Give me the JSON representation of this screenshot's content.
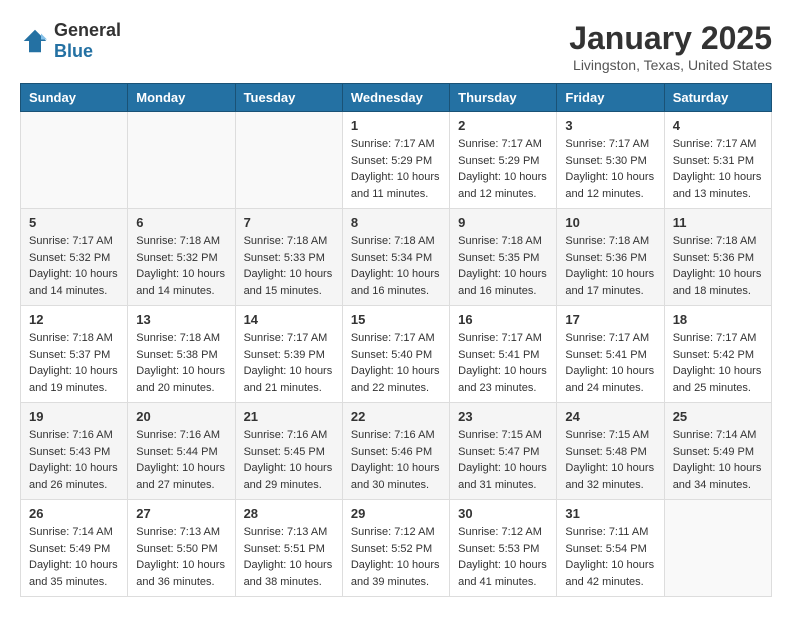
{
  "header": {
    "logo_general": "General",
    "logo_blue": "Blue",
    "month": "January 2025",
    "location": "Livingston, Texas, United States"
  },
  "weekdays": [
    "Sunday",
    "Monday",
    "Tuesday",
    "Wednesday",
    "Thursday",
    "Friday",
    "Saturday"
  ],
  "weeks": [
    [
      {
        "day": "",
        "info": ""
      },
      {
        "day": "",
        "info": ""
      },
      {
        "day": "",
        "info": ""
      },
      {
        "day": "1",
        "info": "Sunrise: 7:17 AM\nSunset: 5:29 PM\nDaylight: 10 hours\nand 11 minutes."
      },
      {
        "day": "2",
        "info": "Sunrise: 7:17 AM\nSunset: 5:29 PM\nDaylight: 10 hours\nand 12 minutes."
      },
      {
        "day": "3",
        "info": "Sunrise: 7:17 AM\nSunset: 5:30 PM\nDaylight: 10 hours\nand 12 minutes."
      },
      {
        "day": "4",
        "info": "Sunrise: 7:17 AM\nSunset: 5:31 PM\nDaylight: 10 hours\nand 13 minutes."
      }
    ],
    [
      {
        "day": "5",
        "info": "Sunrise: 7:17 AM\nSunset: 5:32 PM\nDaylight: 10 hours\nand 14 minutes."
      },
      {
        "day": "6",
        "info": "Sunrise: 7:18 AM\nSunset: 5:32 PM\nDaylight: 10 hours\nand 14 minutes."
      },
      {
        "day": "7",
        "info": "Sunrise: 7:18 AM\nSunset: 5:33 PM\nDaylight: 10 hours\nand 15 minutes."
      },
      {
        "day": "8",
        "info": "Sunrise: 7:18 AM\nSunset: 5:34 PM\nDaylight: 10 hours\nand 16 minutes."
      },
      {
        "day": "9",
        "info": "Sunrise: 7:18 AM\nSunset: 5:35 PM\nDaylight: 10 hours\nand 16 minutes."
      },
      {
        "day": "10",
        "info": "Sunrise: 7:18 AM\nSunset: 5:36 PM\nDaylight: 10 hours\nand 17 minutes."
      },
      {
        "day": "11",
        "info": "Sunrise: 7:18 AM\nSunset: 5:36 PM\nDaylight: 10 hours\nand 18 minutes."
      }
    ],
    [
      {
        "day": "12",
        "info": "Sunrise: 7:18 AM\nSunset: 5:37 PM\nDaylight: 10 hours\nand 19 minutes."
      },
      {
        "day": "13",
        "info": "Sunrise: 7:18 AM\nSunset: 5:38 PM\nDaylight: 10 hours\nand 20 minutes."
      },
      {
        "day": "14",
        "info": "Sunrise: 7:17 AM\nSunset: 5:39 PM\nDaylight: 10 hours\nand 21 minutes."
      },
      {
        "day": "15",
        "info": "Sunrise: 7:17 AM\nSunset: 5:40 PM\nDaylight: 10 hours\nand 22 minutes."
      },
      {
        "day": "16",
        "info": "Sunrise: 7:17 AM\nSunset: 5:41 PM\nDaylight: 10 hours\nand 23 minutes."
      },
      {
        "day": "17",
        "info": "Sunrise: 7:17 AM\nSunset: 5:41 PM\nDaylight: 10 hours\nand 24 minutes."
      },
      {
        "day": "18",
        "info": "Sunrise: 7:17 AM\nSunset: 5:42 PM\nDaylight: 10 hours\nand 25 minutes."
      }
    ],
    [
      {
        "day": "19",
        "info": "Sunrise: 7:16 AM\nSunset: 5:43 PM\nDaylight: 10 hours\nand 26 minutes."
      },
      {
        "day": "20",
        "info": "Sunrise: 7:16 AM\nSunset: 5:44 PM\nDaylight: 10 hours\nand 27 minutes."
      },
      {
        "day": "21",
        "info": "Sunrise: 7:16 AM\nSunset: 5:45 PM\nDaylight: 10 hours\nand 29 minutes."
      },
      {
        "day": "22",
        "info": "Sunrise: 7:16 AM\nSunset: 5:46 PM\nDaylight: 10 hours\nand 30 minutes."
      },
      {
        "day": "23",
        "info": "Sunrise: 7:15 AM\nSunset: 5:47 PM\nDaylight: 10 hours\nand 31 minutes."
      },
      {
        "day": "24",
        "info": "Sunrise: 7:15 AM\nSunset: 5:48 PM\nDaylight: 10 hours\nand 32 minutes."
      },
      {
        "day": "25",
        "info": "Sunrise: 7:14 AM\nSunset: 5:49 PM\nDaylight: 10 hours\nand 34 minutes."
      }
    ],
    [
      {
        "day": "26",
        "info": "Sunrise: 7:14 AM\nSunset: 5:49 PM\nDaylight: 10 hours\nand 35 minutes."
      },
      {
        "day": "27",
        "info": "Sunrise: 7:13 AM\nSunset: 5:50 PM\nDaylight: 10 hours\nand 36 minutes."
      },
      {
        "day": "28",
        "info": "Sunrise: 7:13 AM\nSunset: 5:51 PM\nDaylight: 10 hours\nand 38 minutes."
      },
      {
        "day": "29",
        "info": "Sunrise: 7:12 AM\nSunset: 5:52 PM\nDaylight: 10 hours\nand 39 minutes."
      },
      {
        "day": "30",
        "info": "Sunrise: 7:12 AM\nSunset: 5:53 PM\nDaylight: 10 hours\nand 41 minutes."
      },
      {
        "day": "31",
        "info": "Sunrise: 7:11 AM\nSunset: 5:54 PM\nDaylight: 10 hours\nand 42 minutes."
      },
      {
        "day": "",
        "info": ""
      }
    ]
  ]
}
